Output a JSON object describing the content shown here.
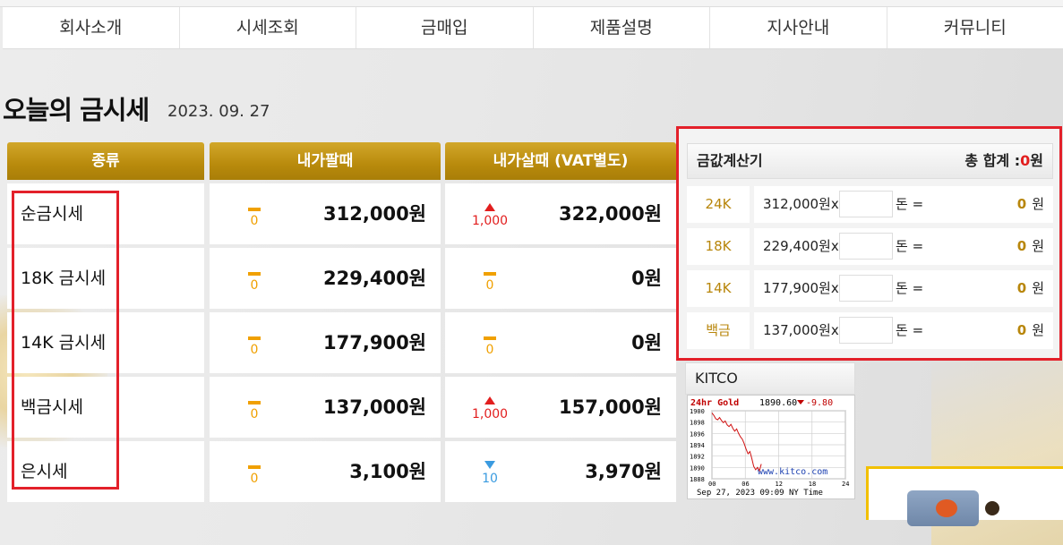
{
  "nav": {
    "items": [
      "회사소개",
      "시세조회",
      "금매입",
      "제품설명",
      "지사안내",
      "커뮤니티"
    ]
  },
  "heading": {
    "title": "오늘의 금시세",
    "date": "2023. 09. 27"
  },
  "price_table": {
    "headers": [
      "종류",
      "내가팔때",
      "내가살때 (VAT별도)"
    ],
    "rows": [
      {
        "name": "순금시세",
        "sell_change": "0",
        "sell_dir": "flat",
        "sell_price": "312,000원",
        "buy_change": "1,000",
        "buy_dir": "up",
        "buy_price": "322,000원"
      },
      {
        "name": "18K 금시세",
        "sell_change": "0",
        "sell_dir": "flat",
        "sell_price": "229,400원",
        "buy_change": "0",
        "buy_dir": "flat",
        "buy_price": "0원"
      },
      {
        "name": "14K 금시세",
        "sell_change": "0",
        "sell_dir": "flat",
        "sell_price": "177,900원",
        "buy_change": "0",
        "buy_dir": "flat",
        "buy_price": "0원"
      },
      {
        "name": "백금시세",
        "sell_change": "0",
        "sell_dir": "flat",
        "sell_price": "137,000원",
        "buy_change": "1,000",
        "buy_dir": "up",
        "buy_price": "157,000원"
      },
      {
        "name": "은시세",
        "sell_change": "0",
        "sell_dir": "flat",
        "sell_price": "3,100원",
        "buy_change": "10",
        "buy_dir": "down",
        "buy_price": "3,970원"
      }
    ]
  },
  "calculator": {
    "title": "금값계산기",
    "total_label": "총 합계 :",
    "total_value": "0",
    "total_unit": "원",
    "multiply": "x",
    "unit_label": "돈 =",
    "currency": "원",
    "rows": [
      {
        "label": "24K",
        "price": "312,000원",
        "input_value": "",
        "result": "0"
      },
      {
        "label": "18K",
        "price": "229,400원",
        "input_value": "",
        "result": "0"
      },
      {
        "label": "14K",
        "price": "177,900원",
        "input_value": "",
        "result": "0"
      },
      {
        "label": "백금",
        "price": "137,000원",
        "input_value": "",
        "result": "0"
      }
    ]
  },
  "kitco": {
    "title": "KITCO",
    "chart_label": "24hr Gold",
    "chart_value": "1890.60",
    "chart_change": "-9.80",
    "y_ticks": [
      "1900",
      "1898",
      "1896",
      "1894",
      "1892",
      "1890",
      "1888"
    ],
    "x_ticks": [
      "00",
      "06",
      "12",
      "18",
      "24"
    ],
    "watermark": "www.kitco.com",
    "timestamp": "Sep 27, 2023 09:09 NY Time",
    "series": [
      1899.6,
      1899.2,
      1898.6,
      1898.4,
      1898.8,
      1898.3,
      1897.9,
      1898.2,
      1897.5,
      1897.2,
      1897.6,
      1896.9,
      1896.4,
      1896.8,
      1896.0,
      1895.4,
      1895.0,
      1894.2,
      1893.2,
      1892.4,
      1892.8,
      1891.6,
      1890.2,
      1889.6,
      1890.0,
      1889.4,
      1890.6
    ]
  },
  "colors": {
    "accent_gold": "#b8860b",
    "up": "#e21e1e",
    "down": "#3a9be0",
    "flat": "#f0a000",
    "highlight": "#e3202a"
  }
}
